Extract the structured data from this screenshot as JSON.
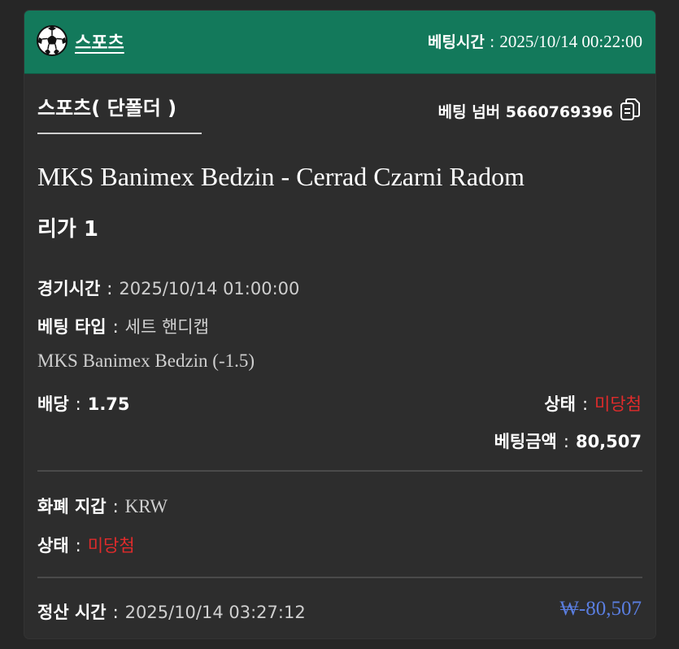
{
  "header": {
    "title": "스포츠",
    "time_label": "베팅시간",
    "time_sep": ":",
    "time_value": "2025/10/14 00:22:00",
    "ball_icon": "soccer-ball-icon"
  },
  "bet": {
    "category": "스포츠( 단폴더 )",
    "number_label": "베팅 넘버",
    "number_value": "5660769396",
    "copy_icon": "copy-icon",
    "match": "MKS Banimex Bedzin - Cerrad Czarni Radom",
    "league": "리가 1",
    "game_time_label": "경기시간",
    "game_time_value": "2025/10/14 01:00:00",
    "bet_type_label": "베팅 타입",
    "bet_type_value": "세트 핸디캡",
    "selection": "MKS Banimex Bedzin (-1.5)",
    "odds_label": "배당",
    "odds_value": "1.75",
    "status_label": "상태",
    "status_value": "미당첨",
    "amount_label": "베팅금액",
    "amount_value": "80,507"
  },
  "wallet": {
    "currency_label": "화폐 지갑",
    "currency_value": "KRW",
    "status_label": "상태",
    "status_value": "미당첨"
  },
  "settlement": {
    "time_label": "정산 시간",
    "time_value": "2025/10/14 03:27:12",
    "amount": "₩-80,507"
  },
  "sep": ":",
  "colors": {
    "header_bg": "#13795b",
    "card_bg": "#2d2d2d",
    "status_red": "#e02b2b",
    "amount_blue": "#5a7ee0"
  }
}
